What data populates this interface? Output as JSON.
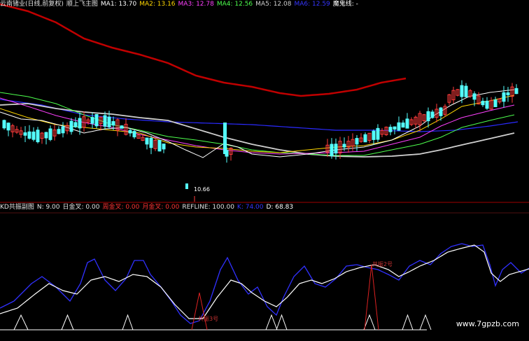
{
  "main_header": {
    "title": "云南锗业(日线,前复权)",
    "indicator": "顺上飞主图",
    "ma1": "MA1: 13.70",
    "ma2": "MA2: 13.16",
    "ma3": "MA3: 12.78",
    "ma4": "MA4: 12.56",
    "ma5": "MA5: 12.08",
    "ma6": "MA6: 12.59",
    "line_label": "魔鬼线: -"
  },
  "sub_header": {
    "name": "KD共振副图",
    "n": "N: 9.00",
    "day_cross": "日金叉: 0.00",
    "week_cross": "周金叉: 0.00",
    "month_cross": "月金叉: 0.00",
    "refline": "REFLINE: 100.00",
    "k": "K: 74.00",
    "d": "D: 68.83"
  },
  "low_price_label": "10.66",
  "signal_labels": [
    "共振3号",
    "共振2号"
  ],
  "watermark": "www.7gpzb.com",
  "colors": {
    "background": "#000000",
    "up_candle": "#ff3b3b",
    "down_candle": "#54ffff",
    "ma1": "#ffffff",
    "ma2": "#ffd700",
    "ma3": "#ff40ff",
    "ma4": "#4dff4d",
    "ma5": "#cfcfcf",
    "ma6": "#2a2aff",
    "red_line": "#c00000",
    "k_line": "#3030ff",
    "d_line": "#ffffff",
    "separator": "#a00000"
  }
}
